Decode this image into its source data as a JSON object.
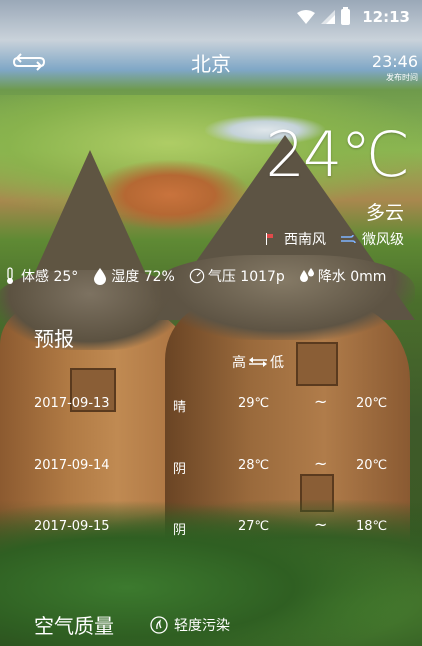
{
  "status_bar": {
    "time": "12:13"
  },
  "header": {
    "city": "北京",
    "update_time": "23:46",
    "update_label": "发布时间"
  },
  "now": {
    "temperature": "24℃",
    "condition": "多云",
    "wind_direction": "西南风",
    "wind_level": "微风级"
  },
  "details": {
    "feels_like": "体感 25°",
    "humidity": "湿度 72%",
    "pressure": "气压 1017p",
    "precipitation": "降水 0mm"
  },
  "forecast": {
    "title": "预报",
    "high_label": "高",
    "low_label": "低",
    "rows": [
      {
        "date": "2017-09-13",
        "condition": "晴",
        "high": "29℃",
        "sep": "~",
        "low": "20℃"
      },
      {
        "date": "2017-09-14",
        "condition": "阴",
        "high": "28℃",
        "sep": "~",
        "low": "20℃"
      },
      {
        "date": "2017-09-15",
        "condition": "阴",
        "high": "27℃",
        "sep": "~",
        "low": "18℃"
      }
    ]
  },
  "air_quality": {
    "title": "空气质量",
    "status": "轻度污染"
  },
  "icons": {
    "back": "refresh-arrows-icon",
    "feels_like": "thermometer-icon",
    "humidity": "drop-icon",
    "pressure": "gauge-icon",
    "precipitation": "rain-drops-icon",
    "air_quality": "leaf-icon"
  }
}
